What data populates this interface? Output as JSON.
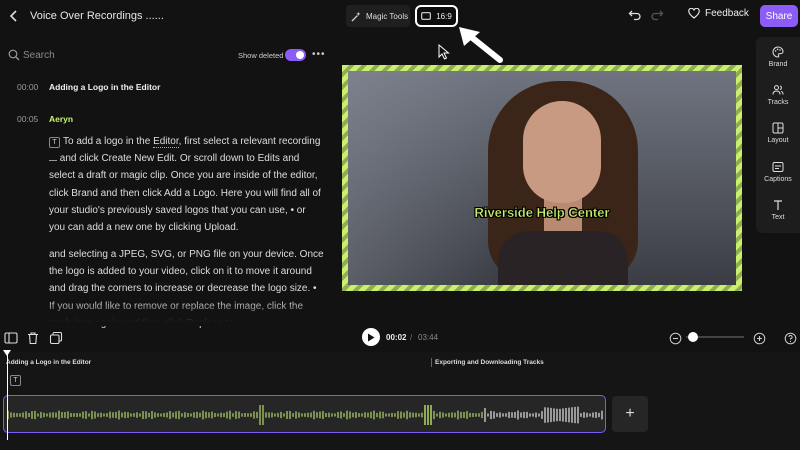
{
  "header": {
    "title": "Voice Over Recordings ......",
    "magic_tools_label": "Magic Tools",
    "aspect_ratio": "16:9",
    "feedback_label": "Feedback",
    "share_label": "Share"
  },
  "transcript": {
    "search_placeholder": "Search",
    "show_deleted_label": "Show deleted",
    "show_deleted_on": true,
    "blocks": [
      {
        "time": "00:00",
        "title": "Adding a Logo in the Editor"
      },
      {
        "time": "00:05",
        "speaker": "Aeryn"
      }
    ],
    "p1": {
      "t1": "To add a logo in the ",
      "editor": "Editor",
      "t2": ", first select a relevant recording ",
      "t3": " and click Create New Edit. Or scroll down to Edits and select a draft or magic clip. Once you are inside of the editor, click Brand and then click Add a Logo. Here you will find all of your studio's previously saved logos that you can use, • or you can add a new one by clicking Upload."
    },
    "p2": "and selecting a JPEG, SVG, or PNG file on your device. Once the logo is added to your video, click on it to move it around and drag the corners to increase or decrease the logo size. • If you would like to remove or replace the image, click the trash icon again and then click Replace to"
  },
  "preview": {
    "caption": "Riverside Help Center",
    "accent_color": "#c9f06b"
  },
  "sidebar": {
    "items": [
      {
        "label": "Brand",
        "icon": "palette-icon"
      },
      {
        "label": "Tracks",
        "icon": "people-icon"
      },
      {
        "label": "Layout",
        "icon": "layout-icon"
      },
      {
        "label": "Captions",
        "icon": "captions-icon"
      },
      {
        "label": "Text",
        "icon": "text-icon"
      }
    ]
  },
  "transport": {
    "current_time": "00:02",
    "separator": "/",
    "duration": "03:44"
  },
  "timeline": {
    "segments": [
      {
        "label": "Adding a Logo in the Editor"
      },
      {
        "label": "Exporting and Downloading Tracks"
      }
    ],
    "add_track_label": "+"
  }
}
